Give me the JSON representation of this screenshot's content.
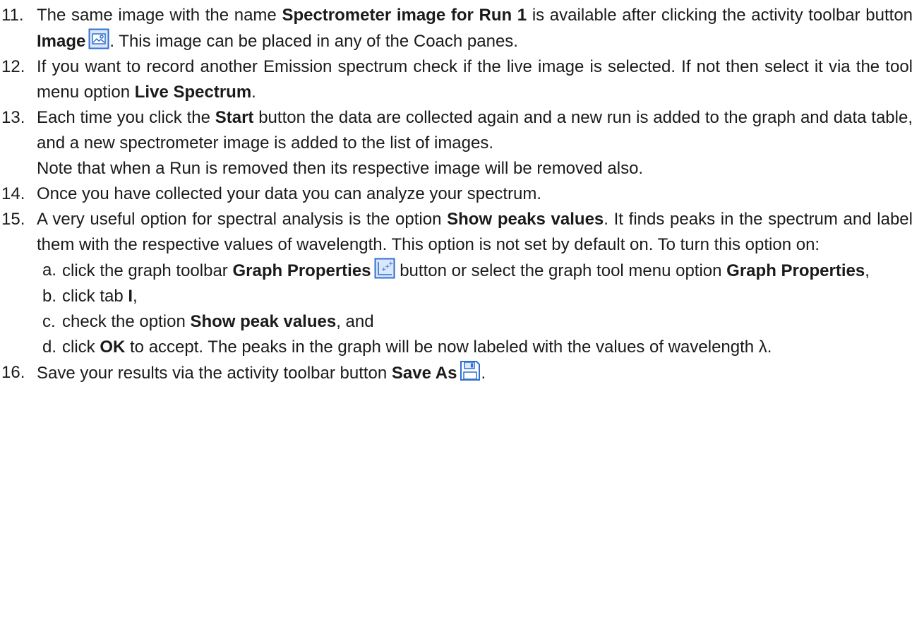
{
  "steps": [
    {
      "num": "11.",
      "t1": "The same image with the name ",
      "b1": "Spectrometer image for Run 1",
      "t2": " is available after clicking the activity toolbar button ",
      "b2": "Image",
      "t3": ". This image can be placed in any of the Coach panes.",
      "icon": "image-icon"
    },
    {
      "num": "12.",
      "t1": "If you want to record another Emission spectrum check if the live image is selected. If not then select it via the tool menu option ",
      "b1": "Live Spectrum",
      "t2": "."
    },
    {
      "num": "13.",
      "t1": "Each time you click the ",
      "b1": "Start",
      "t2": " button the data are collected again and a new run is added to the graph and data table, and a new spectrometer image is added to the list of images.",
      "note": "Note that when a Run is removed then its respective image will be removed also."
    },
    {
      "num": "14.",
      "t1": "Once you have collected your data you can analyze your spectrum."
    },
    {
      "num": "15.",
      "t1": "A very useful option for spectral analysis is the option ",
      "b1": "Show peaks values",
      "t2": ". It finds peaks in the spectrum and label them with the respective values of wavelength. This option is not set by default on. To turn this option on:",
      "sub": [
        {
          "letter": "a.",
          "t1": "click the graph toolbar ",
          "b1": "Graph Properties",
          "t2": " button or select the graph tool menu option ",
          "b2": "Graph Properties",
          "t3": ",",
          "icon": "graph-properties-icon"
        },
        {
          "letter": "b.",
          "t1": "click tab ",
          "b1": "I",
          "t2": ","
        },
        {
          "letter": "c.",
          "t1": "check the option ",
          "b1": "Show peak values",
          "t2": ", and"
        },
        {
          "letter": "d.",
          "t1": "click ",
          "b1": "OK",
          "t2": " to accept. The peaks in the graph will be now labeled with the values of wavelength λ."
        }
      ]
    },
    {
      "num": "16.",
      "t1": "Save your results via the activity toolbar button ",
      "b1": "Save As",
      "t2": ".",
      "icon": "save-icon"
    }
  ],
  "colors": {
    "icon_blue": "#2f6fd0",
    "icon_fill": "#dbe8fa",
    "text": "#1a1a1a"
  }
}
